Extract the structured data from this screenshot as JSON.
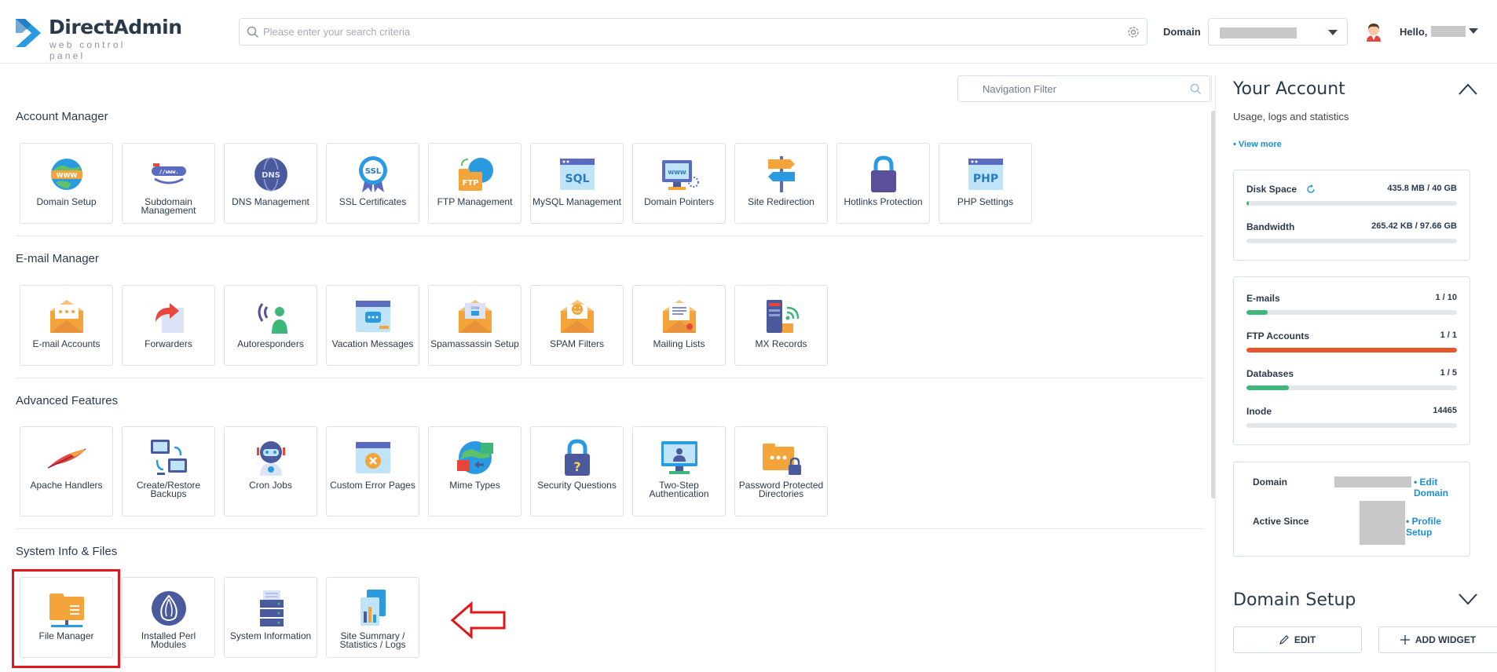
{
  "app": {
    "name": "DirectAdmin",
    "subtitle": "web control panel"
  },
  "header": {
    "search_placeholder": "Please enter your search criteria",
    "domain_label": "Domain",
    "hello": "Hello,"
  },
  "nav_filter": {
    "placeholder": "Navigation Filter"
  },
  "sections": [
    {
      "title": "Account Manager",
      "items": [
        {
          "label": "Domain Setup",
          "icon": "www-globe-icon"
        },
        {
          "label": "Subdomain Management",
          "icon": "subdomain-icon"
        },
        {
          "label": "DNS Management",
          "icon": "dns-globe-icon"
        },
        {
          "label": "SSL Certificates",
          "icon": "ssl-badge-icon"
        },
        {
          "label": "FTP Management",
          "icon": "ftp-folder-icon"
        },
        {
          "label": "MySQL Management",
          "icon": "sql-window-icon"
        },
        {
          "label": "Domain Pointers",
          "icon": "domain-pointer-monitor-icon"
        },
        {
          "label": "Site Redirection",
          "icon": "signpost-icon"
        },
        {
          "label": "Hotlinks Protection",
          "icon": "padlock-icon"
        },
        {
          "label": "PHP Settings",
          "icon": "php-window-icon"
        }
      ]
    },
    {
      "title": "E-mail Manager",
      "items": [
        {
          "label": "E-mail Accounts",
          "icon": "envelope-icon"
        },
        {
          "label": "Forwarders",
          "icon": "forward-arrow-icon"
        },
        {
          "label": "Autoresponders",
          "icon": "person-signal-icon"
        },
        {
          "label": "Vacation Messages",
          "icon": "chat-window-icon"
        },
        {
          "label": "Spamassassin Setup",
          "icon": "spam-envelope-icon"
        },
        {
          "label": "SPAM Filters",
          "icon": "smile-envelope-icon"
        },
        {
          "label": "Mailing Lists",
          "icon": "list-envelope-icon"
        },
        {
          "label": "MX Records",
          "icon": "server-signal-icon"
        }
      ]
    },
    {
      "title": "Advanced Features",
      "items": [
        {
          "label": "Apache Handlers",
          "icon": "feather-icon"
        },
        {
          "label": "Create/Restore Backups",
          "icon": "backup-monitors-icon"
        },
        {
          "label": "Cron Jobs",
          "icon": "robot-icon"
        },
        {
          "label": "Custom Error Pages",
          "icon": "error-window-icon"
        },
        {
          "label": "Mime Types",
          "icon": "mime-globe-icon"
        },
        {
          "label": "Security Questions",
          "icon": "question-lock-icon"
        },
        {
          "label": "Two-Step Authentication",
          "icon": "two-step-monitor-icon"
        },
        {
          "label": "Password Protected Directories",
          "icon": "locked-folder-icon"
        }
      ]
    },
    {
      "title": "System Info & Files",
      "items": [
        {
          "label": "File Manager",
          "icon": "folder-icon"
        },
        {
          "label": "Installed Perl Modules",
          "icon": "perl-onion-icon"
        },
        {
          "label": "System Information",
          "icon": "server-stack-icon"
        },
        {
          "label": "Site Summary / Statistics / Logs",
          "icon": "stats-chart-icon"
        }
      ]
    }
  ],
  "account": {
    "title": "Your Account",
    "subtitle": "Usage, logs and statistics",
    "view_more": "• View more",
    "usage": [
      {
        "label": "Disk Space",
        "value": "435.8 MB / 40 GB",
        "percent": 1,
        "color": "#3db87a"
      },
      {
        "label": "Bandwidth",
        "value": "265.42 KB / 97.66 GB",
        "percent": 0,
        "color": "#3db87a"
      }
    ],
    "counts": [
      {
        "label": "E-mails",
        "value": "1 / 10",
        "percent": 10,
        "color": "#3db87a"
      },
      {
        "label": "FTP Accounts",
        "value": "1 / 1",
        "percent": 100,
        "color": "#e8572a"
      },
      {
        "label": "Databases",
        "value": "1 / 5",
        "percent": 20,
        "color": "#3db87a"
      },
      {
        "label": "Inode",
        "value": "14465",
        "percent": 0,
        "color": "#3db87a"
      }
    ],
    "domain_label": "Domain",
    "edit_domain": "• Edit Domain",
    "active_since_label": "Active Since",
    "profile_setup": "• Profile Setup"
  },
  "domain_setup": {
    "title": "Domain Setup",
    "edit": "EDIT",
    "add_widget": "ADD WIDGET"
  }
}
